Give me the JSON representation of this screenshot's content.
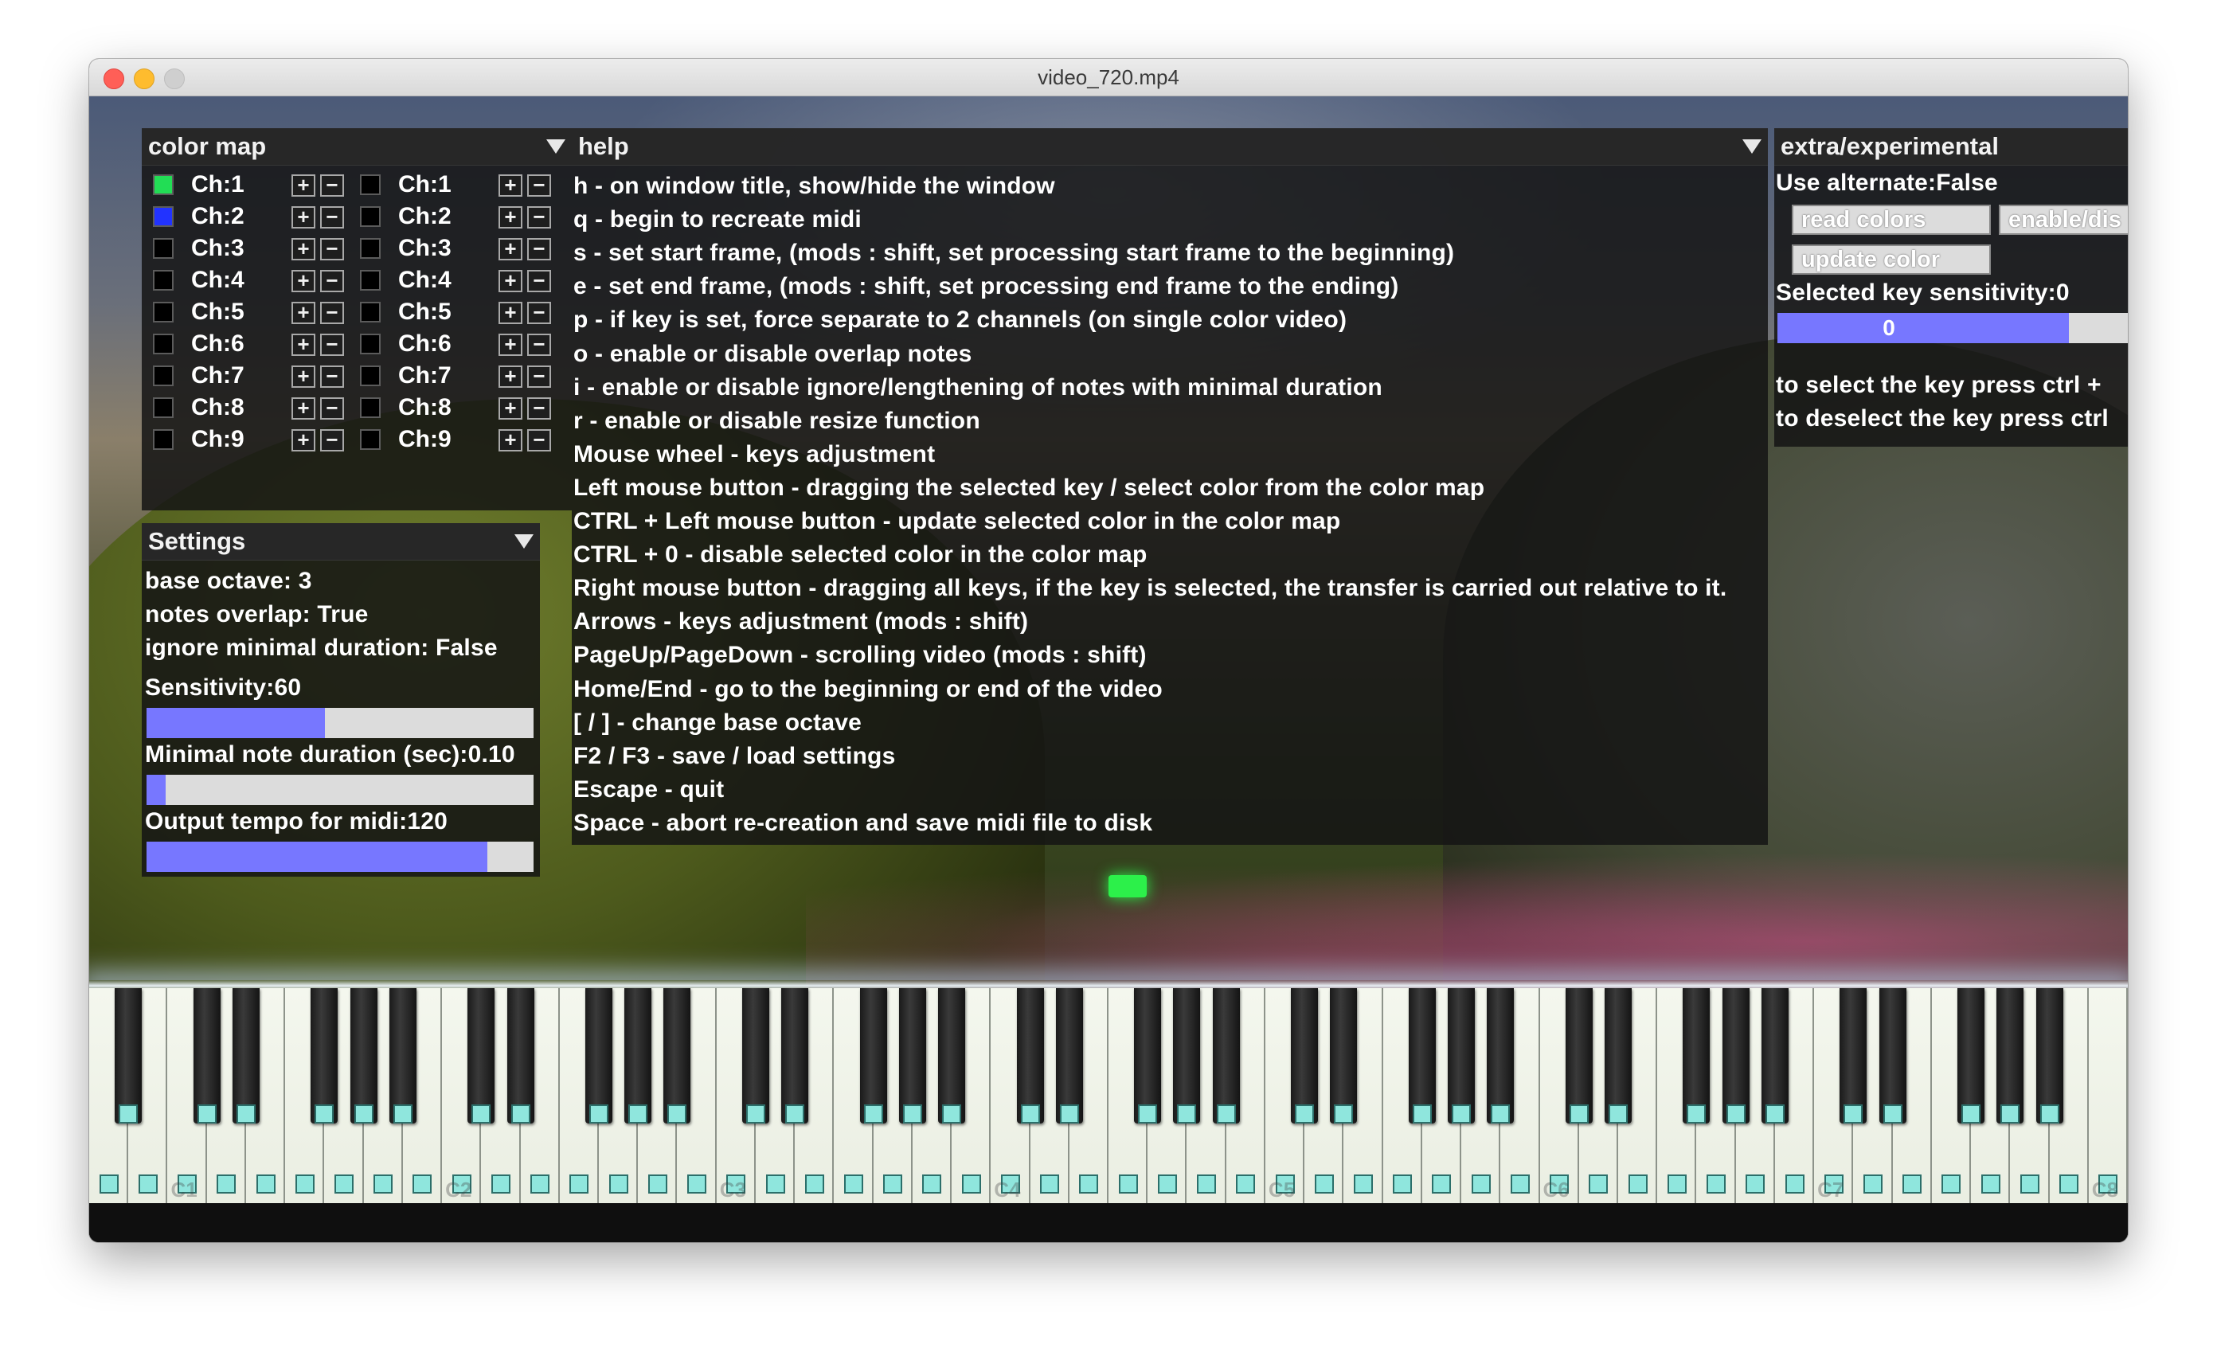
{
  "window": {
    "title": "video_720.mp4"
  },
  "color_map": {
    "title": "color map",
    "channels_left": [
      {
        "label": "Ch:1",
        "swatch": "#22dd55"
      },
      {
        "label": "Ch:2",
        "swatch": "#2233ff"
      },
      {
        "label": "Ch:3",
        "swatch": "#000000"
      },
      {
        "label": "Ch:4",
        "swatch": "#000000"
      },
      {
        "label": "Ch:5",
        "swatch": "#000000"
      },
      {
        "label": "Ch:6",
        "swatch": "#000000"
      },
      {
        "label": "Ch:7",
        "swatch": "#000000"
      },
      {
        "label": "Ch:8",
        "swatch": "#000000"
      },
      {
        "label": "Ch:9",
        "swatch": "#000000"
      }
    ],
    "channels_right": [
      {
        "label": "Ch:1",
        "swatch": "#000000"
      },
      {
        "label": "Ch:2",
        "swatch": "#000000"
      },
      {
        "label": "Ch:3",
        "swatch": "#000000"
      },
      {
        "label": "Ch:4",
        "swatch": "#000000"
      },
      {
        "label": "Ch:5",
        "swatch": "#000000"
      },
      {
        "label": "Ch:6",
        "swatch": "#000000"
      },
      {
        "label": "Ch:7",
        "swatch": "#000000"
      },
      {
        "label": "Ch:8",
        "swatch": "#000000"
      },
      {
        "label": "Ch:9",
        "swatch": "#000000"
      }
    ],
    "plus": "+",
    "minus": "−"
  },
  "settings": {
    "title": "Settings",
    "base_octave": "base octave: 3",
    "notes_overlap": "notes overlap: True",
    "ignore_min": "ignore minimal duration: False",
    "sensitivity_label": "Sensitivity:60",
    "sensitivity_fraction": 0.46,
    "min_duration_label": "Minimal note duration (sec):0.10",
    "min_duration_fraction": 0.05,
    "tempo_label": "Output tempo for midi:120",
    "tempo_fraction": 0.88
  },
  "help": {
    "title": "help",
    "lines": [
      "h - on window title, show/hide the window",
      "q - begin to recreate midi",
      "s - set start frame, (mods : shift, set processing start frame to the beginning)",
      "e - set end frame, (mods : shift, set processing end frame to the ending)",
      "p - if key is set, force separate to 2 channels (on single color video)",
      "o - enable or disable overlap notes",
      "i - enable or disable ignore/lengthening of notes with minimal duration",
      "r - enable or disable resize function",
      "Mouse wheel - keys adjustment",
      "Left mouse button - dragging the selected key / select color from the color map",
      "CTRL + Left mouse button - update selected color in the color map",
      "CTRL + 0 - disable selected color in the color map",
      "Right mouse button - dragging all keys, if the key is selected, the transfer is carried out relative to it.",
      "Arrows - keys adjustment (mods : shift)",
      "PageUp/PageDown - scrolling video (mods : shift)",
      "Home/End - go to the beginning or end of the video",
      "[ / ] - change base octave",
      "F2 / F3 - save / load settings",
      "Escape - quit",
      "Space - abort re-creation and save midi file to disk"
    ]
  },
  "extra": {
    "title": "extra/experimental",
    "use_alternate": "Use alternate:False",
    "read_colors": "read colors",
    "enable_dis": "enable/dis",
    "update_color": "update color",
    "key_sensitivity_label": "Selected key sensitivity:0",
    "key_sensitivity_value": "0",
    "select_hint": "to select the key press ctrl +",
    "deselect_hint": "to deselect the key press ctrl"
  },
  "piano": {
    "octave_labels": [
      "C1",
      "C2",
      "C3",
      "C4",
      "C5",
      "C6",
      "C7",
      "C8"
    ],
    "accent": "#8fe6dd"
  }
}
